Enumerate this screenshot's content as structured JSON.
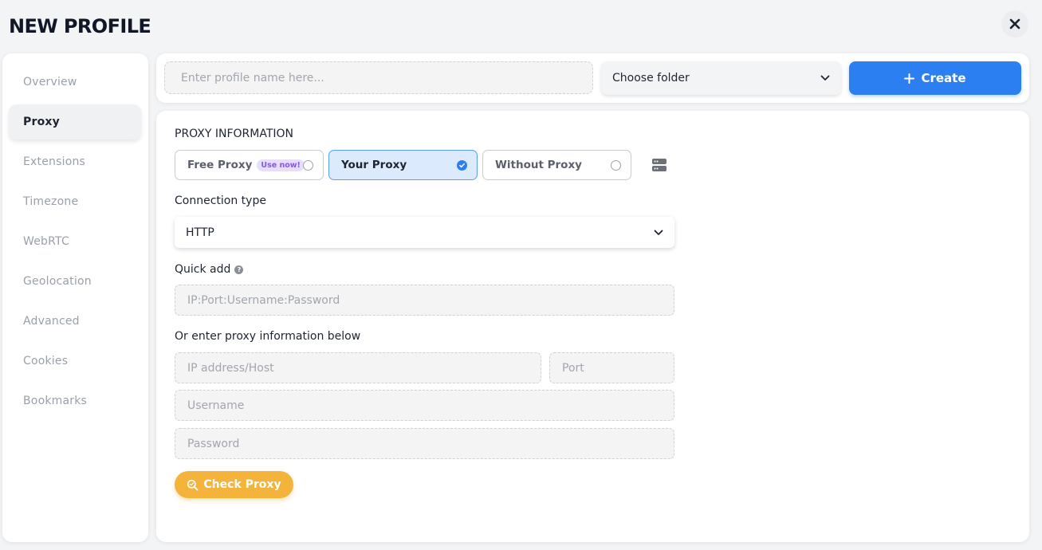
{
  "header": {
    "title": "NEW PROFILE"
  },
  "sidebar": {
    "items": [
      {
        "label": "Overview"
      },
      {
        "label": "Proxy"
      },
      {
        "label": "Extensions"
      },
      {
        "label": "Timezone"
      },
      {
        "label": "WebRTC"
      },
      {
        "label": "Geolocation"
      },
      {
        "label": "Advanced"
      },
      {
        "label": "Cookies"
      },
      {
        "label": "Bookmarks"
      }
    ],
    "active": "Proxy"
  },
  "topbar": {
    "name_placeholder": "Enter profile name here...",
    "folder_value": "Choose folder",
    "create_label": "Create"
  },
  "proxy": {
    "section_title": "PROXY INFORMATION",
    "options": [
      {
        "label": "Free Proxy",
        "badge": "Use now!"
      },
      {
        "label": "Your Proxy"
      },
      {
        "label": "Without Proxy"
      }
    ],
    "selected": "Your Proxy",
    "connection_label": "Connection type",
    "connection_value": "HTTP",
    "quick_add_label": "Quick add",
    "quick_add_placeholder": "IP:Port:Username:Password",
    "manual_label": "Or enter proxy information below",
    "host_placeholder": "IP address/Host",
    "port_placeholder": "Port",
    "username_placeholder": "Username",
    "password_placeholder": "Password",
    "check_label": "Check Proxy"
  },
  "colors": {
    "accent": "#2b7ff1",
    "check_button": "#f4b33a",
    "badge_bg": "#e7ddfc",
    "badge_text": "#8758e6"
  }
}
